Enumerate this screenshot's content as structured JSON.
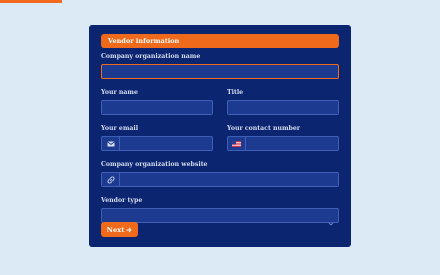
{
  "colors": {
    "accent": "#ef6a1a",
    "card": "#0b2571",
    "field": "#1c3a8f",
    "page_bg": "#dbeaf5"
  },
  "form": {
    "section_title": "Vendor information",
    "fields": {
      "company_name": {
        "label": "Company organization name",
        "value": "",
        "placeholder": ""
      },
      "your_name": {
        "label": "Your name",
        "value": "",
        "placeholder": ""
      },
      "title": {
        "label": "Title",
        "value": "",
        "placeholder": ""
      },
      "email": {
        "label": "Your email",
        "value": "",
        "placeholder": "",
        "icon": "mail-icon"
      },
      "contact_number": {
        "label": "Your contact number",
        "value": "",
        "placeholder": "",
        "icon": "us-flag-icon"
      },
      "website": {
        "label": "Company organization website",
        "value": "",
        "placeholder": "",
        "icon": "link-icon"
      },
      "vendor_type": {
        "label": "Vendor type",
        "selected": "",
        "icon": "chevron-down-icon"
      }
    },
    "next_button": {
      "label": "Next",
      "icon": "arrow-right-icon"
    }
  }
}
